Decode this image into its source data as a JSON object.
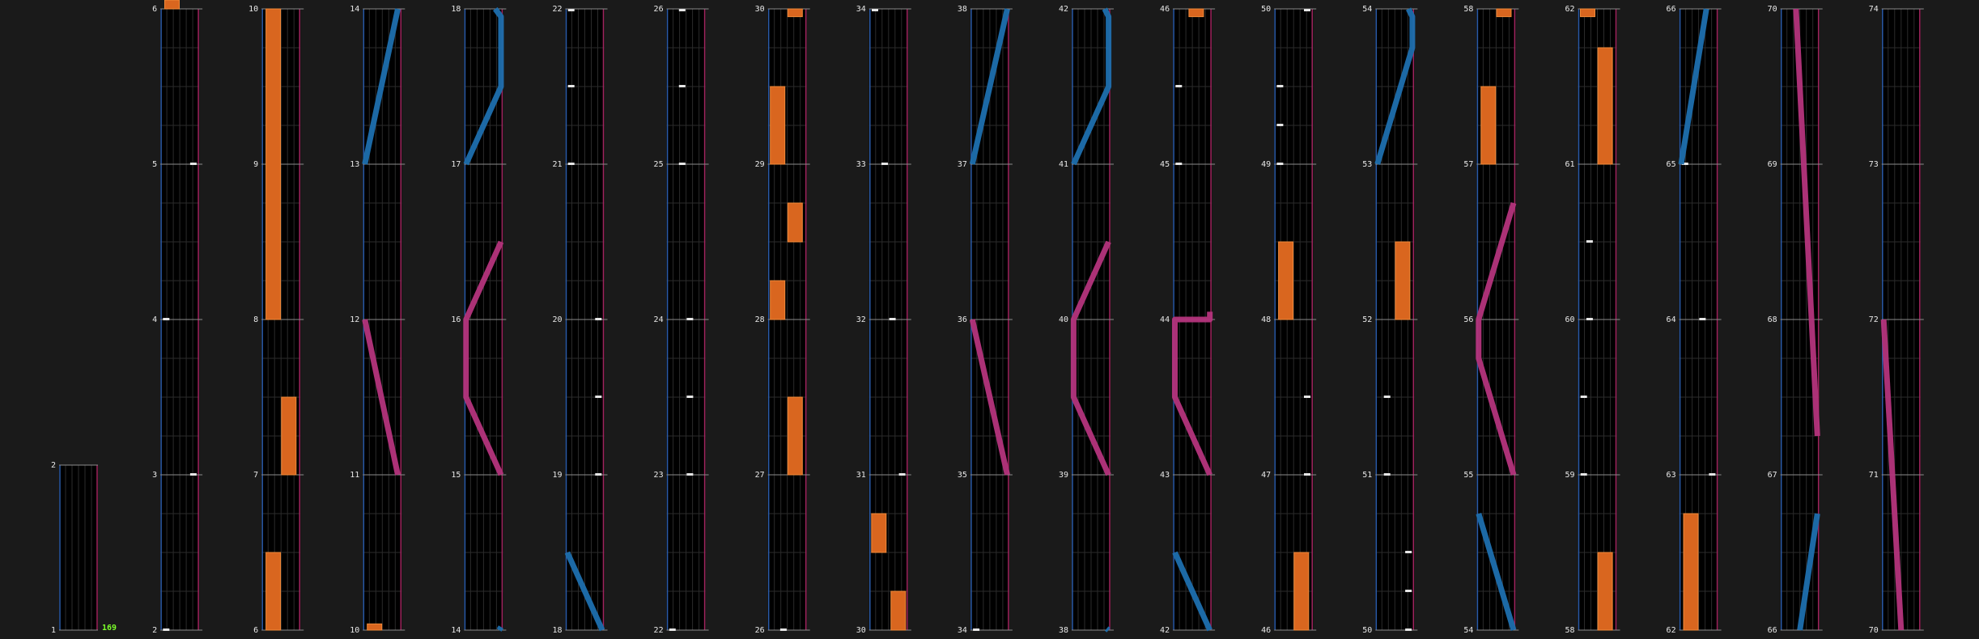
{
  "colors": {
    "background": "#1a1a1a",
    "lane_bg": "#000000",
    "lane_line": "#2b2b2b",
    "left_border": "#2a5aa8",
    "right_border": "#a0245e",
    "measure_line": "#8c8c8c",
    "tap_note": "#e6e6e6",
    "hold_note": "#d9661f",
    "blue_slide": "#1d6fae",
    "pink_slide": "#b4347c",
    "combo_text": "#7cff2a",
    "label_text": "#e8e8e8"
  },
  "combo": "169",
  "columns": [
    {
      "index": 0,
      "measures": [
        "1",
        "2"
      ],
      "partial_top": true,
      "notes": []
    },
    {
      "index": 1,
      "measures": [
        "2",
        "3",
        "4",
        "5",
        "6"
      ],
      "notes": [
        {
          "t": "tap",
          "lane": 0.15,
          "m": 0.0
        },
        {
          "t": "tap",
          "lane": 0.85,
          "m": 1.0
        },
        {
          "t": "tap",
          "lane": 0.15,
          "m": 2.0
        },
        {
          "t": "tap",
          "lane": 0.85,
          "m": 3.0
        },
        {
          "t": "hold",
          "lane": 0.3,
          "m0": 4.0,
          "m1": 4.08
        }
      ]
    },
    {
      "index": 2,
      "measures": [
        "6",
        "7",
        "8",
        "9",
        "10"
      ],
      "notes": [
        {
          "t": "hold",
          "lane": 0.3,
          "m0": 0.0,
          "m1": 0.5
        },
        {
          "t": "hold",
          "lane": 0.7,
          "m0": 1.0,
          "m1": 1.5
        },
        {
          "t": "hold",
          "lane": 0.3,
          "m0": 2.0,
          "m1": 4.0
        }
      ]
    },
    {
      "index": 3,
      "measures": [
        "10",
        "11",
        "12",
        "13",
        "14"
      ],
      "notes": [
        {
          "t": "hold",
          "lane": 0.3,
          "m0": 0.0,
          "m1": 0.04
        },
        {
          "t": "slide",
          "c": "pink",
          "pts": [
            [
              0.05,
              2.0
            ],
            [
              0.9,
              1.0
            ]
          ]
        },
        {
          "t": "slide",
          "c": "blue",
          "pts": [
            [
              0.05,
              3.0
            ],
            [
              0.9,
              4.0
            ]
          ]
        }
      ]
    },
    {
      "index": 4,
      "measures": [
        "14",
        "15",
        "16",
        "17",
        "18"
      ],
      "notes": [
        {
          "t": "slide",
          "c": "blue",
          "pts": [
            [
              0.9,
              0.0
            ],
            [
              0.95,
              0.02
            ]
          ]
        },
        {
          "t": "slide",
          "c": "pink",
          "pts": [
            [
              0.95,
              1.0
            ],
            [
              0.05,
              1.5
            ],
            [
              0.05,
              2.0
            ],
            [
              0.95,
              2.5
            ]
          ]
        },
        {
          "t": "slide",
          "c": "blue",
          "pts": [
            [
              0.05,
              3.0
            ],
            [
              0.95,
              3.5
            ],
            [
              0.95,
              3.95
            ],
            [
              0.8,
              4.0
            ]
          ]
        }
      ]
    },
    {
      "index": 5,
      "measures": [
        "18",
        "19",
        "20",
        "21",
        "22"
      ],
      "notes": [
        {
          "t": "slide",
          "c": "blue",
          "pts": [
            [
              0.05,
              0.5
            ],
            [
              0.95,
              0.0
            ]
          ]
        },
        {
          "t": "tap",
          "lane": 0.85,
          "m": 1.0
        },
        {
          "t": "tap",
          "lane": 0.85,
          "m": 1.5
        },
        {
          "t": "tap",
          "lane": 0.85,
          "m": 2.0
        },
        {
          "t": "tap",
          "lane": 0.15,
          "m": 3.0
        },
        {
          "t": "tap",
          "lane": 0.15,
          "m": 3.5
        },
        {
          "t": "tap",
          "lane": 0.15,
          "m": 4.0
        }
      ]
    },
    {
      "index": 6,
      "measures": [
        "22",
        "23",
        "24",
        "25",
        "26"
      ],
      "notes": [
        {
          "t": "tap",
          "lane": 0.15,
          "m": 0.0
        },
        {
          "t": "tap",
          "lane": 0.6,
          "m": 1.0
        },
        {
          "t": "tap",
          "lane": 0.6,
          "m": 1.5
        },
        {
          "t": "tap",
          "lane": 0.6,
          "m": 2.0
        },
        {
          "t": "tap",
          "lane": 0.4,
          "m": 3.0
        },
        {
          "t": "tap",
          "lane": 0.4,
          "m": 3.5
        },
        {
          "t": "tap",
          "lane": 0.4,
          "m": 4.0
        }
      ]
    },
    {
      "index": 7,
      "measures": [
        "26",
        "27",
        "28",
        "29",
        "30"
      ],
      "notes": [
        {
          "t": "tap",
          "lane": 0.4,
          "m": 0.0
        },
        {
          "t": "hold",
          "lane": 0.7,
          "m0": 1.0,
          "m1": 1.5
        },
        {
          "t": "hold",
          "lane": 0.25,
          "m0": 2.0,
          "m1": 2.25
        },
        {
          "t": "hold",
          "lane": 0.7,
          "m0": 2.5,
          "m1": 2.75
        },
        {
          "t": "hold",
          "lane": 0.25,
          "m0": 3.0,
          "m1": 3.5
        },
        {
          "t": "hold",
          "lane": 0.7,
          "m0": 3.95,
          "m1": 4.0
        }
      ]
    },
    {
      "index": 8,
      "measures": [
        "30",
        "31",
        "32",
        "33",
        "34"
      ],
      "notes": [
        {
          "t": "hold",
          "lane": 0.75,
          "m0": 0.0,
          "m1": 0.25
        },
        {
          "t": "hold",
          "lane": 0.25,
          "m0": 0.5,
          "m1": 0.75
        },
        {
          "t": "tap",
          "lane": 0.85,
          "m": 1.0
        },
        {
          "t": "tap",
          "lane": 0.6,
          "m": 2.0
        },
        {
          "t": "tap",
          "lane": 0.4,
          "m": 3.0
        },
        {
          "t": "tap",
          "lane": 0.15,
          "m": 4.0
        }
      ]
    },
    {
      "index": 9,
      "measures": [
        "34",
        "35",
        "36",
        "37",
        "38"
      ],
      "notes": [
        {
          "t": "tap",
          "lane": 0.15,
          "m": 0.0
        },
        {
          "t": "slide",
          "c": "pink",
          "pts": [
            [
              0.05,
              2.0
            ],
            [
              0.95,
              1.0
            ]
          ]
        },
        {
          "t": "slide",
          "c": "blue",
          "pts": [
            [
              0.05,
              3.0
            ],
            [
              0.95,
              4.0
            ]
          ]
        }
      ]
    },
    {
      "index": 10,
      "measures": [
        "38",
        "39",
        "40",
        "41",
        "42"
      ],
      "notes": [
        {
          "t": "slide",
          "c": "blue",
          "pts": [
            [
              0.95,
              0.0
            ],
            [
              0.9,
              0.01
            ]
          ]
        },
        {
          "t": "slide",
          "c": "pink",
          "pts": [
            [
              0.95,
              1.0
            ],
            [
              0.05,
              1.5
            ],
            [
              0.05,
              2.0
            ],
            [
              0.95,
              2.5
            ]
          ]
        },
        {
          "t": "slide",
          "c": "blue",
          "pts": [
            [
              0.05,
              3.0
            ],
            [
              0.95,
              3.5
            ],
            [
              0.95,
              3.95
            ],
            [
              0.85,
              4.0
            ]
          ]
        }
      ]
    },
    {
      "index": 11,
      "measures": [
        "42",
        "43",
        "44",
        "45",
        "46"
      ],
      "notes": [
        {
          "t": "slide",
          "c": "blue",
          "pts": [
            [
              0.05,
              0.5
            ],
            [
              0.95,
              0.0
            ]
          ]
        },
        {
          "t": "slide",
          "c": "pink",
          "pts": [
            [
              0.95,
              1.0
            ],
            [
              0.05,
              1.5
            ],
            [
              0.05,
              2.0
            ],
            [
              0.95,
              2.0
            ],
            [
              0.95,
              2.05
            ]
          ]
        },
        {
          "t": "tap",
          "lane": 0.15,
          "m": 3.0
        },
        {
          "t": "tap",
          "lane": 0.15,
          "m": 3.5
        },
        {
          "t": "hold",
          "lane": 0.6,
          "m0": 3.95,
          "m1": 4.0
        }
      ]
    },
    {
      "index": 12,
      "measures": [
        "46",
        "47",
        "48",
        "49",
        "50"
      ],
      "notes": [
        {
          "t": "hold",
          "lane": 0.7,
          "m0": 0.0,
          "m1": 0.5
        },
        {
          "t": "tap",
          "lane": 0.85,
          "m": 1.0
        },
        {
          "t": "tap",
          "lane": 0.85,
          "m": 1.5
        },
        {
          "t": "hold",
          "lane": 0.3,
          "m0": 2.0,
          "m1": 2.5
        },
        {
          "t": "tap",
          "lane": 0.15,
          "m": 3.0
        },
        {
          "t": "tap",
          "lane": 0.15,
          "m": 3.25
        },
        {
          "t": "tap",
          "lane": 0.15,
          "m": 3.5
        },
        {
          "t": "tap",
          "lane": 0.85,
          "m": 4.0
        }
      ]
    },
    {
      "index": 13,
      "measures": [
        "50",
        "51",
        "52",
        "53",
        "54"
      ],
      "notes": [
        {
          "t": "tap",
          "lane": 0.85,
          "m": 0.0
        },
        {
          "t": "tap",
          "lane": 0.85,
          "m": 0.25
        },
        {
          "t": "tap",
          "lane": 0.85,
          "m": 0.5
        },
        {
          "t": "tap",
          "lane": 0.3,
          "m": 1.0
        },
        {
          "t": "tap",
          "lane": 0.3,
          "m": 1.5
        },
        {
          "t": "hold",
          "lane": 0.7,
          "m0": 2.0,
          "m1": 2.5
        },
        {
          "t": "slide",
          "c": "blue",
          "pts": [
            [
              0.05,
              3.0
            ],
            [
              0.95,
              3.75
            ],
            [
              0.95,
              3.95
            ],
            [
              0.85,
              4.0
            ]
          ]
        }
      ]
    },
    {
      "index": 14,
      "measures": [
        "54",
        "55",
        "56",
        "57",
        "58"
      ],
      "notes": [
        {
          "t": "slide",
          "c": "blue",
          "pts": [
            [
              0.05,
              0.75
            ],
            [
              0.95,
              0.0
            ]
          ]
        },
        {
          "t": "slide",
          "c": "pink",
          "pts": [
            [
              0.95,
              1.0
            ],
            [
              0.05,
              1.75
            ],
            [
              0.05,
              2.0
            ],
            [
              0.95,
              2.75
            ]
          ]
        },
        {
          "t": "hold",
          "lane": 0.3,
          "m0": 3.0,
          "m1": 3.5
        },
        {
          "t": "hold",
          "lane": 0.7,
          "m0": 3.95,
          "m1": 4.0
        }
      ]
    },
    {
      "index": 15,
      "measures": [
        "58",
        "59",
        "60",
        "61",
        "62"
      ],
      "notes": [
        {
          "t": "hold",
          "lane": 0.7,
          "m0": 0.0,
          "m1": 0.5
        },
        {
          "t": "tap",
          "lane": 0.15,
          "m": 1.0
        },
        {
          "t": "tap",
          "lane": 0.15,
          "m": 1.5
        },
        {
          "t": "tap",
          "lane": 0.3,
          "m": 2.0
        },
        {
          "t": "tap",
          "lane": 0.3,
          "m": 2.5
        },
        {
          "t": "hold",
          "lane": 0.7,
          "m0": 3.0,
          "m1": 3.75
        },
        {
          "t": "hold",
          "lane": 0.25,
          "m0": 3.95,
          "m1": 4.0
        }
      ]
    },
    {
      "index": 16,
      "measures": [
        "62",
        "63",
        "64",
        "65",
        "66"
      ],
      "notes": [
        {
          "t": "hold",
          "lane": 0.3,
          "m0": 0.0,
          "m1": 0.75
        },
        {
          "t": "tap",
          "lane": 0.85,
          "m": 1.0
        },
        {
          "t": "tap",
          "lane": 0.6,
          "m": 2.0
        },
        {
          "t": "tap",
          "lane": 0.15,
          "m": 3.0
        },
        {
          "t": "slide",
          "c": "blue",
          "pts": [
            [
              0.05,
              3.0
            ],
            [
              0.7,
              4.0
            ]
          ]
        }
      ]
    },
    {
      "index": 17,
      "measures": [
        "66",
        "67",
        "68",
        "69",
        "70"
      ],
      "notes": [
        {
          "t": "slide",
          "c": "blue",
          "pts": [
            [
              0.5,
              0.0
            ],
            [
              0.95,
              0.75
            ]
          ]
        },
        {
          "t": "slide",
          "c": "pink",
          "pts": [
            [
              0.95,
              1.25
            ],
            [
              0.4,
              4.0
            ]
          ]
        }
      ]
    },
    {
      "index": 18,
      "measures": [
        "70",
        "71",
        "72",
        "73",
        "74"
      ],
      "notes": [
        {
          "t": "slide",
          "c": "pink",
          "pts": [
            [
              0.5,
              0.0
            ],
            [
              0.05,
              2.0
            ]
          ]
        }
      ]
    }
  ]
}
